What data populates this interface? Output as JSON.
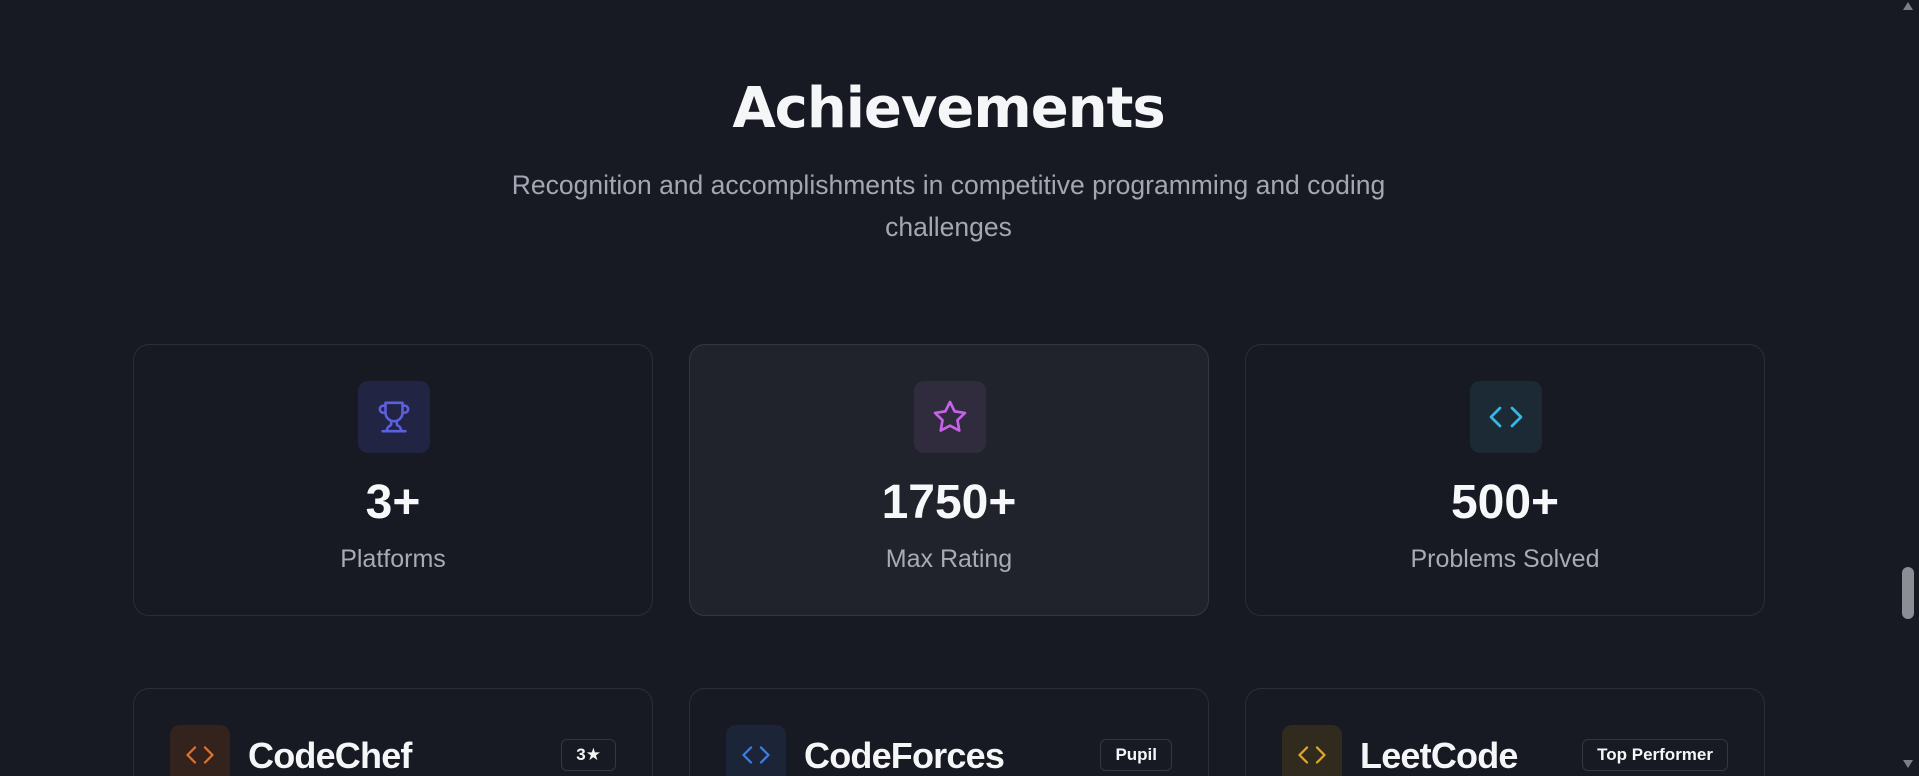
{
  "section": {
    "title": "Achievements",
    "subtitle_line1": "Recognition and accomplishments in competitive programming and coding",
    "subtitle_line2": "challenges"
  },
  "stats": [
    {
      "icon": "trophy-icon",
      "value": "3+",
      "label": "Platforms",
      "accent": "#5b5fe0"
    },
    {
      "icon": "star-icon",
      "value": "1750+",
      "label": "Max Rating",
      "accent": "#c462e8"
    },
    {
      "icon": "code-icon",
      "value": "500+",
      "label": "Problems Solved",
      "accent": "#38b6e6"
    }
  ],
  "platforms": [
    {
      "icon": "code-icon",
      "name": "CodeChef",
      "badge": "3★",
      "accent": "#e0732d"
    },
    {
      "icon": "code-icon",
      "name": "CodeForces",
      "badge": "Pupil",
      "accent": "#3b7fe6"
    },
    {
      "icon": "code-icon",
      "name": "LeetCode",
      "badge": "Top Performer",
      "accent": "#e0a82b"
    }
  ]
}
